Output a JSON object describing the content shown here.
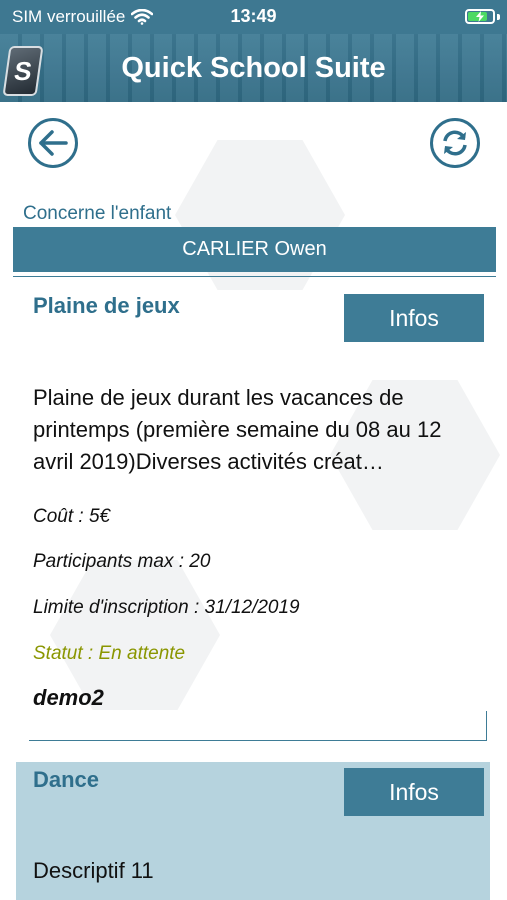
{
  "status_bar": {
    "carrier": "SIM verrouillée",
    "time": "13:49",
    "battery_level": 0.8
  },
  "header": {
    "logo_letter": "S",
    "title": "Quick School Suite"
  },
  "nav": {
    "back_icon": "arrow-left-icon",
    "refresh_icon": "refresh-icon"
  },
  "child": {
    "label": "Concerne l'enfant",
    "name": "CARLIER Owen"
  },
  "activities": [
    {
      "title": "Plaine de jeux",
      "infos_label": "Infos",
      "description": "Plaine de jeux durant les vacances de printemps (première semaine du 08 au 12 avril 2019)Diverses activités créat…",
      "cost": "Coût : 5€",
      "participants": "Participants max : 20",
      "deadline": "Limite d'inscription : 31/12/2019",
      "status": "Statut : En attente",
      "author": "demo2"
    },
    {
      "title": "Dance",
      "infos_label": "Infos",
      "description": "Descriptif 11"
    }
  ],
  "colors": {
    "primary": "#3e7c96",
    "status_pending": "#8a9600",
    "selected_card": "#b6d3de"
  }
}
